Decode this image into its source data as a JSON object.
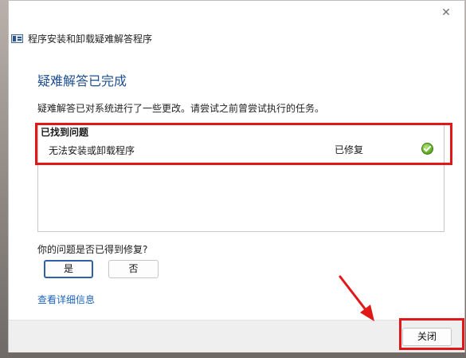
{
  "window": {
    "title": "程序安装和卸载疑难解答程序",
    "close_glyph": "✕"
  },
  "main": {
    "heading": "疑难解答已完成",
    "description": "疑难解答已对系统进行了一些更改。请尝试之前曾尝试执行的任务。",
    "problems_title": "已找到问题",
    "problems": [
      {
        "name": "无法安装或卸载程序",
        "status": "已修复",
        "status_icon": "check-circle-icon"
      }
    ],
    "question": "你的问题是否已得到修复?",
    "yes_label": "是",
    "no_label": "否",
    "details_link": "查看详细信息"
  },
  "footer": {
    "close_label": "关闭"
  },
  "colors": {
    "heading": "#1e4e8f",
    "link": "#1c63b8",
    "annotation_red": "#e01818",
    "status_green": "#6cb22c"
  }
}
